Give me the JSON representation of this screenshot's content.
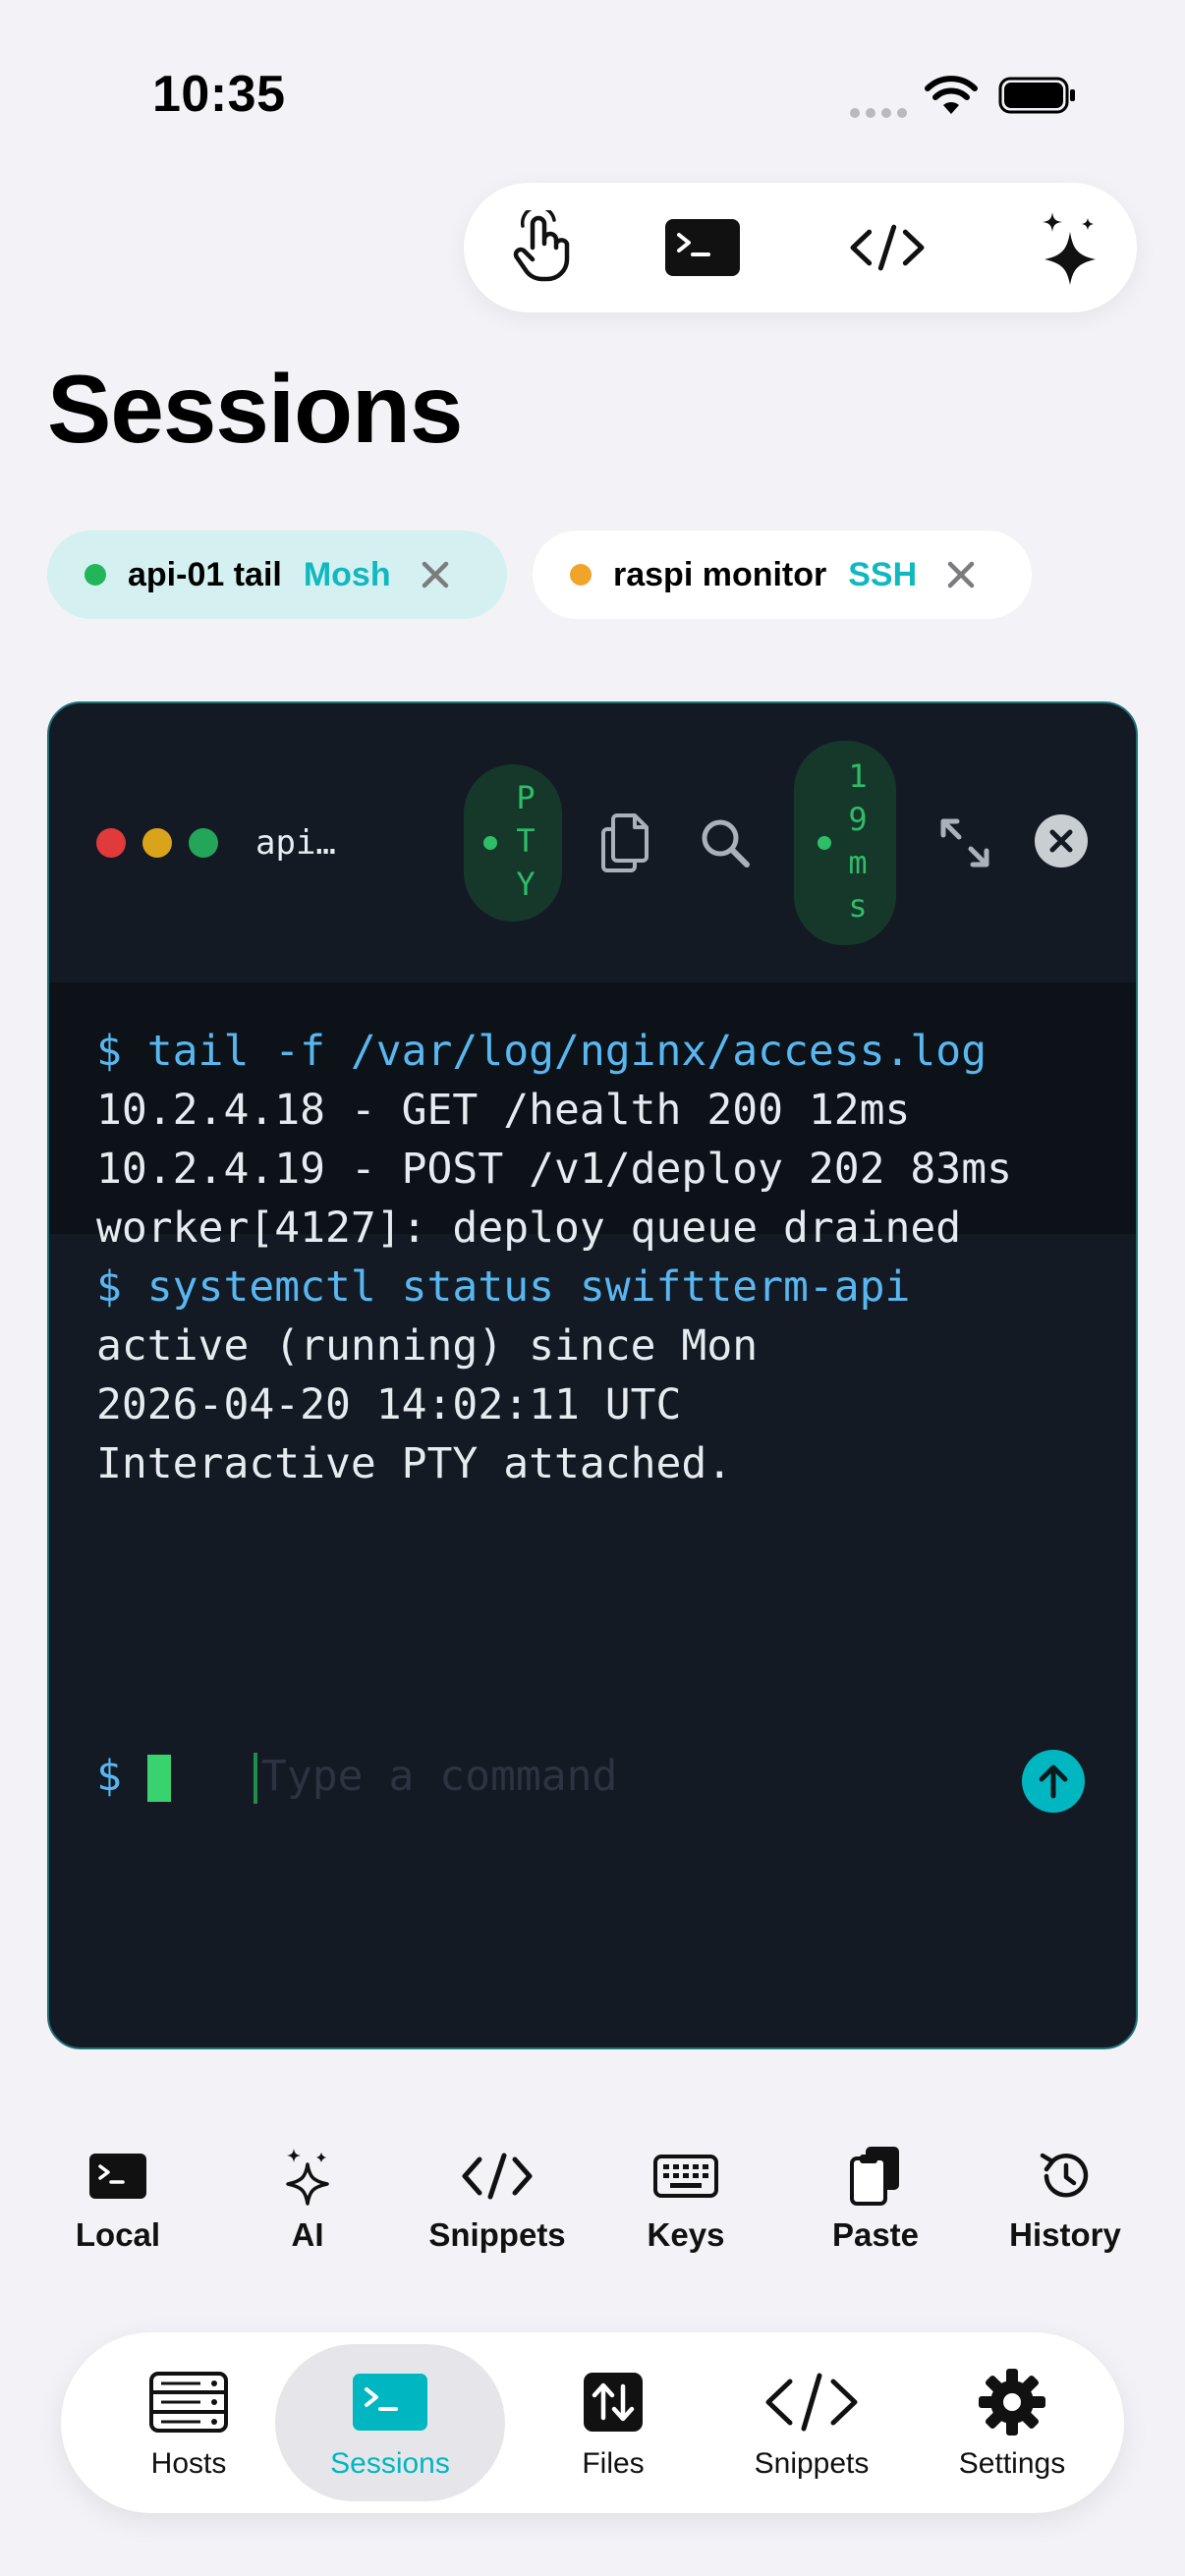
{
  "status_bar": {
    "time": "10:35"
  },
  "top_toolbar": {
    "items": [
      {
        "icon": "hand-tap-icon"
      },
      {
        "icon": "terminal-icon"
      },
      {
        "icon": "code-icon"
      },
      {
        "icon": "sparkles-icon"
      }
    ]
  },
  "page": {
    "title": "Sessions"
  },
  "session_chips": [
    {
      "name": "api-01 tail",
      "protocol": "Mosh",
      "dot_color": "#22b55a",
      "active": true
    },
    {
      "name": "raspi monitor",
      "protocol": "SSH",
      "dot_color": "#f0a52a",
      "active": false
    }
  ],
  "terminal": {
    "title": "api…",
    "pty_badge": [
      "P",
      "T",
      "Y"
    ],
    "latency_badge": [
      "1",
      "9",
      "m",
      "s"
    ],
    "output": [
      {
        "text": "$ tail -f /var/log/nginx/access.log",
        "kind": "cmd"
      },
      {
        "text": "10.2.4.18 - GET /health 200 12ms",
        "kind": "out"
      },
      {
        "text": "10.2.4.19 - POST /v1/deploy 202 83ms",
        "kind": "out"
      },
      {
        "text": "worker[4127]: deploy queue drained",
        "kind": "out"
      },
      {
        "text": "$ systemctl status swiftterm-api",
        "kind": "cmd"
      },
      {
        "text": "active (running) since Mon",
        "kind": "out"
      },
      {
        "text": "2026-04-20 14:02:11 UTC",
        "kind": "out"
      },
      {
        "text": "Interactive PTY attached.",
        "kind": "out"
      }
    ],
    "prompt": "$",
    "input_placeholder": "Type a command"
  },
  "quick_actions": [
    {
      "label": "Local",
      "icon": "terminal-icon"
    },
    {
      "label": "AI",
      "icon": "sparkles-icon"
    },
    {
      "label": "Snippets",
      "icon": "code-icon"
    },
    {
      "label": "Keys",
      "icon": "keyboard-icon"
    },
    {
      "label": "Paste",
      "icon": "paste-icon"
    },
    {
      "label": "History",
      "icon": "history-icon"
    }
  ],
  "tab_bar": {
    "items": [
      {
        "label": "Hosts",
        "icon": "server-icon"
      },
      {
        "label": "Sessions",
        "icon": "terminal-icon",
        "active": true
      },
      {
        "label": "Files",
        "icon": "transfer-icon"
      },
      {
        "label": "Snippets",
        "icon": "code-icon"
      },
      {
        "label": "Settings",
        "icon": "gear-icon"
      }
    ]
  },
  "colors": {
    "accent": "#00b7c1",
    "terminal_bg": "#141a24",
    "output_bg": "#0d1218",
    "ok_green": "#2ebd68"
  }
}
